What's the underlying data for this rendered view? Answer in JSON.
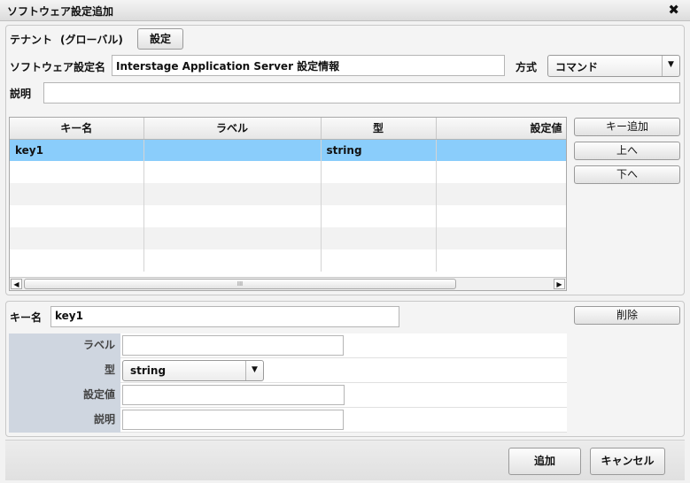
{
  "window": {
    "title": "ソフトウェア設定追加",
    "close_glyph": "✖"
  },
  "tenant": {
    "label": "テナント",
    "value": "(グローバル)",
    "button": "設定"
  },
  "software": {
    "label": "ソフトウェア設定名",
    "value": "Interstage Application Server 設定情報"
  },
  "method": {
    "label": "方式",
    "value": "コマンド",
    "arrow": "▼"
  },
  "description": {
    "label": "説明",
    "value": ""
  },
  "grid": {
    "columns": [
      "キー名",
      "ラベル",
      "型",
      "設定値"
    ],
    "rows": [
      {
        "key": "key1",
        "label": "",
        "type": "string",
        "value": ""
      }
    ],
    "scroll": {
      "left": "◀",
      "right": "▶",
      "thumb": "III"
    }
  },
  "side_buttons": {
    "add_key": "キー追加",
    "up": "上へ",
    "down": "下へ",
    "delete": "削除"
  },
  "detail": {
    "key_label": "キー名",
    "key_value": "key1",
    "fields": {
      "label": {
        "label": "ラベル",
        "value": ""
      },
      "type": {
        "label": "型",
        "value": "string",
        "arrow": "▼"
      },
      "value": {
        "label": "設定値",
        "value": ""
      },
      "desc": {
        "label": "説明",
        "value": ""
      }
    }
  },
  "footer": {
    "ok": "追加",
    "cancel": "キャンセル"
  },
  "colors": {
    "selected_row": "#8acdfb",
    "detail_label_bg": "#cfd6e0"
  }
}
